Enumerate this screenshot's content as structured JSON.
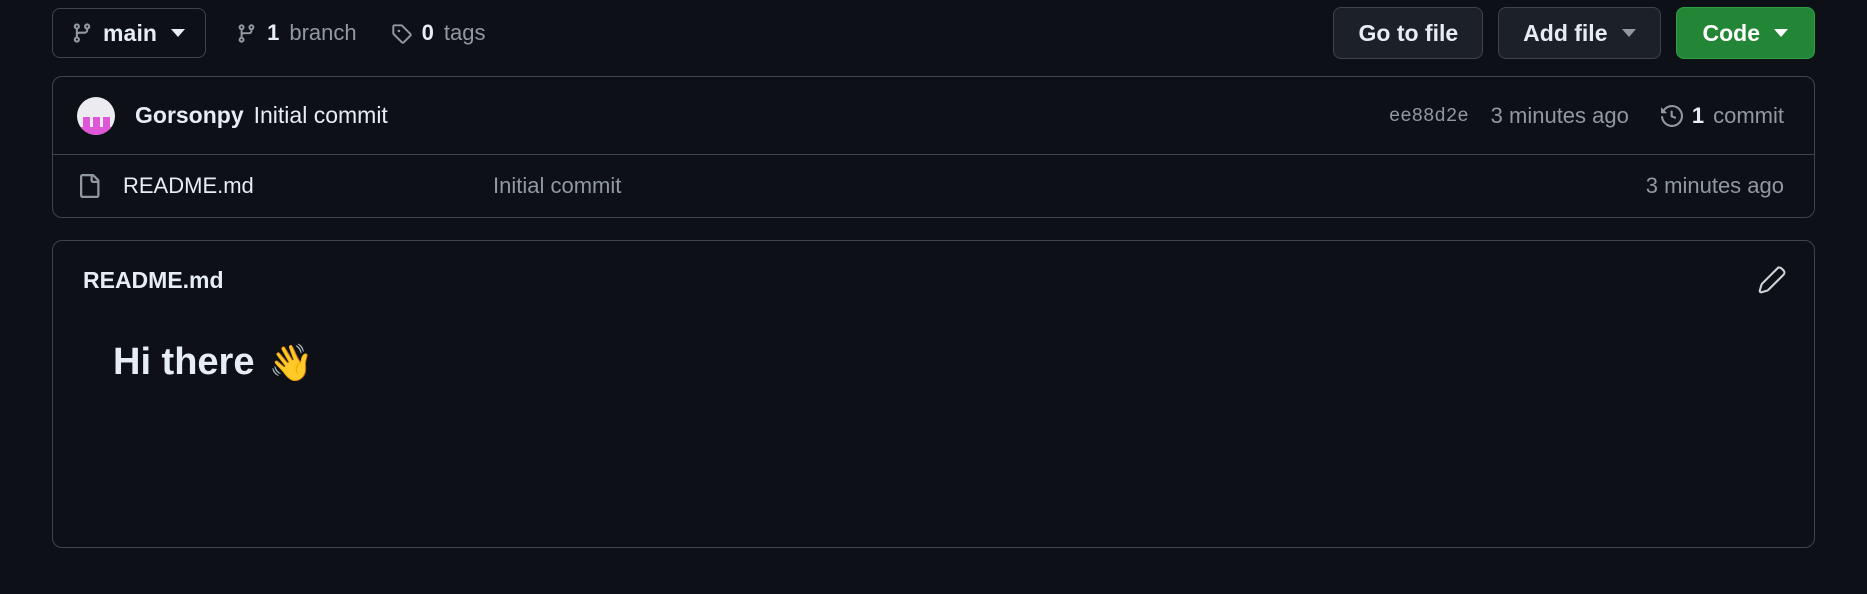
{
  "colors": {
    "background": "#0d1117",
    "border": "#3d444d",
    "text": "#e6edf3",
    "muted": "#9198a1",
    "accent_green": "#238636"
  },
  "toolbar": {
    "branch": {
      "icon": "branch-icon",
      "label": "main",
      "caret": "chevron-down-icon"
    },
    "stats": [
      {
        "icon": "branch-icon",
        "count": "1",
        "label": "branch"
      },
      {
        "icon": "tag-icon",
        "count": "0",
        "label": "tags"
      }
    ],
    "buttons": [
      {
        "label": "Go to file",
        "style": "default",
        "caret": false
      },
      {
        "label": "Add file",
        "style": "default",
        "caret": true
      },
      {
        "label": "Code",
        "style": "primary",
        "caret": true
      }
    ]
  },
  "commit": {
    "avatar_alt": "Gorsonpy avatar",
    "author": "Gorsonpy",
    "message": "Initial commit",
    "sha": "ee88d2e",
    "time": "3 minutes ago",
    "history_icon": "history-icon",
    "commits_count": "1",
    "commits_label": "commit"
  },
  "files": [
    {
      "icon": "file-icon",
      "name": "README.md",
      "commit_message": "Initial commit",
      "time": "3 minutes ago"
    }
  ],
  "readme": {
    "title": "README.md",
    "edit_icon": "pencil-icon",
    "heading": "Hi there",
    "emoji": "👋"
  }
}
